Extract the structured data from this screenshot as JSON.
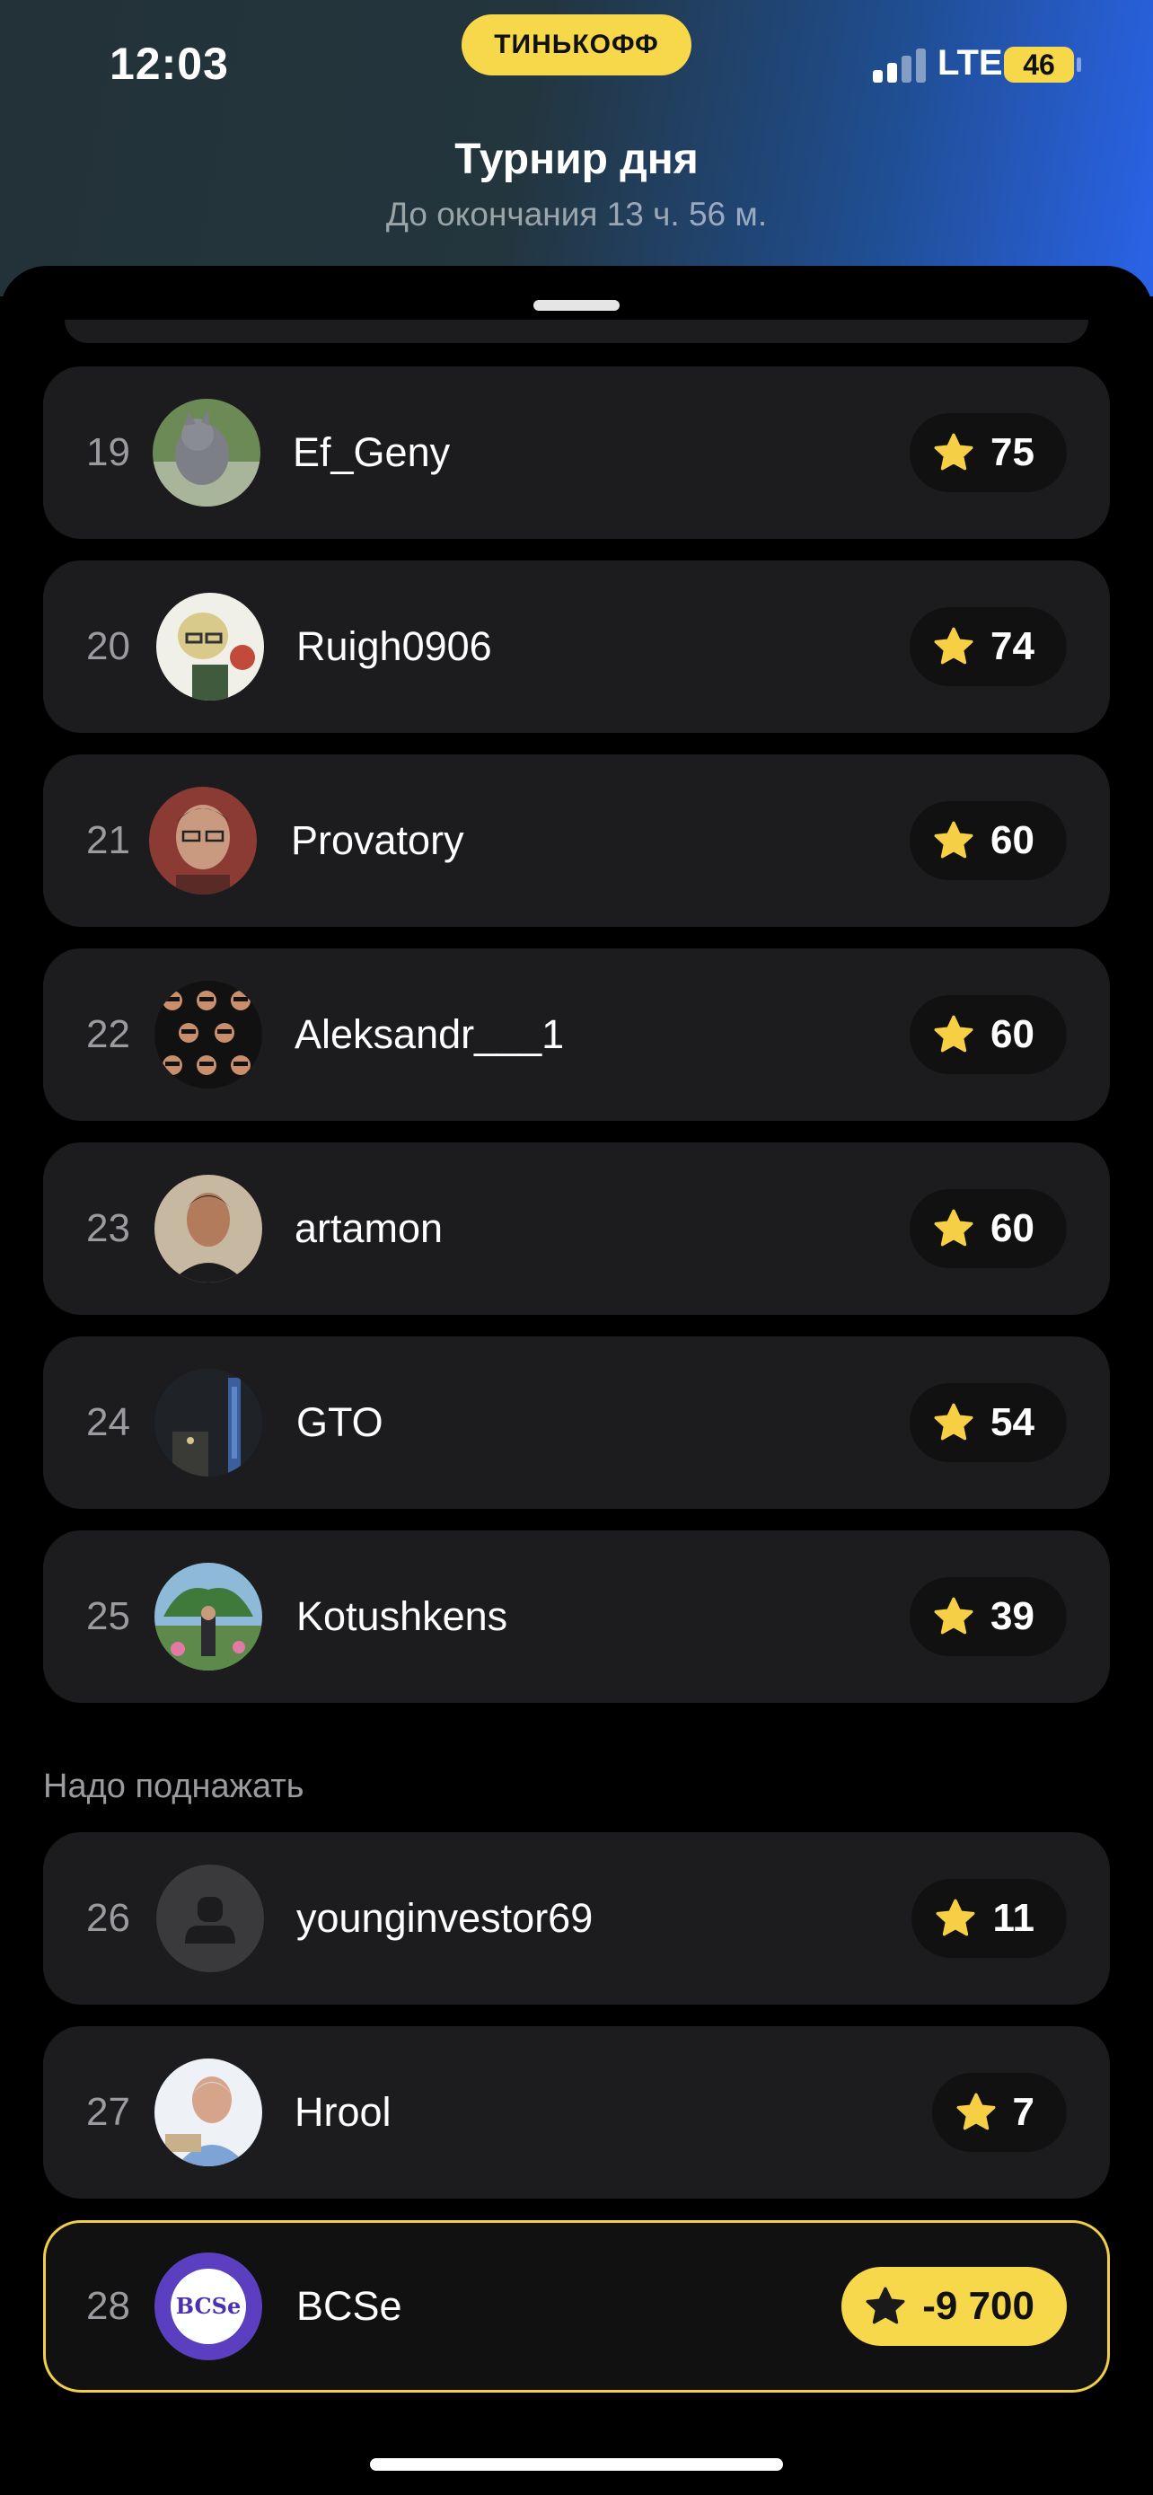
{
  "status_bar": {
    "time": "12:03",
    "bank_badge": "ТИНЬКОФФ",
    "network": "LTE",
    "battery": "46"
  },
  "header": {
    "title": "Турнир дня",
    "subtitle": "До окончания 13 ч. 56 м."
  },
  "section": {
    "label": "Надо поднажать"
  },
  "rows": [
    {
      "rank": "19",
      "name": "Ef_Geny",
      "score": "75",
      "avatar": "cat-photo"
    },
    {
      "rank": "20",
      "name": "Ruigh0906",
      "score": "74",
      "avatar": "anime-character"
    },
    {
      "rank": "21",
      "name": "Provatory",
      "score": "60",
      "avatar": "man-portrait"
    },
    {
      "rank": "22",
      "name": "Aleksandr___1",
      "score": "60",
      "avatar": "repeated-faces-pattern"
    },
    {
      "rank": "23",
      "name": "artamon",
      "score": "60",
      "avatar": "man-portrait"
    },
    {
      "rank": "24",
      "name": "GTO",
      "score": "54",
      "avatar": "night-city"
    },
    {
      "rank": "25",
      "name": "Kotushkens",
      "score": "39",
      "avatar": "graduation-photo"
    },
    {
      "rank": "26",
      "name": "younginvestor69",
      "score": "11",
      "avatar": "default-user"
    },
    {
      "rank": "27",
      "name": "Hrool",
      "score": "7",
      "avatar": "man-at-desk"
    },
    {
      "rank": "28",
      "name": "BCSe",
      "score": "-9 700",
      "avatar": "BCSe",
      "highlighted": true
    }
  ],
  "colors": {
    "accent_yellow": "#f7d84a",
    "row_bg": "#1c1c1e",
    "highlight_border": "#f2cd4a"
  }
}
